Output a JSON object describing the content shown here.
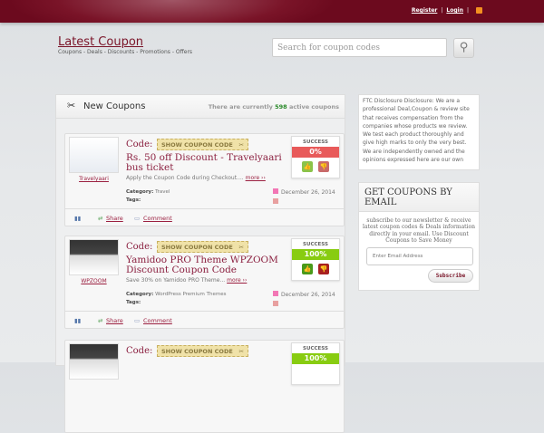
{
  "topbar": {
    "register": "Register",
    "login": "Login",
    "sep": "|"
  },
  "site": {
    "title": "Latest Coupon",
    "tagline": "Coupons - Deals - Discounts - Promotions - Offers"
  },
  "search": {
    "placeholder": "Search for coupon codes"
  },
  "panel": {
    "title": "New Coupons",
    "count_prefix": "There are currently",
    "count": "598",
    "count_suffix": "active coupons"
  },
  "coupons": [
    {
      "store": "Travelyaari",
      "code_label": "Code:",
      "show_code": "SHOW COUPON CODE",
      "title": "Rs. 50 off Discount - Travelyaari bus ticket",
      "desc": "Apply the Coupon Code during Checkout....",
      "more": "more ››",
      "category_label": "Category:",
      "category": "Travel",
      "tags_label": "Tags:",
      "date": "December 26, 2014",
      "success_label": "SUCCESS",
      "success": "0%",
      "share": "Share",
      "comment": "Comment",
      "success_color": "#e85a5a"
    },
    {
      "store": "WPZOOM",
      "code_label": "Code:",
      "show_code": "SHOW COUPON CODE",
      "title": "Yamidoo PRO Theme WPZOOM Discount Coupon Code",
      "desc": "Save 30% on Yamidoo PRO Theme...",
      "more": "more ››",
      "category_label": "Category:",
      "category": "WordPress Premium Themes",
      "tags_label": "Tags:",
      "date": "December 26, 2014",
      "success_label": "SUCCESS",
      "success": "100%",
      "share": "Share",
      "comment": "Comment",
      "success_color": "#88cc11"
    },
    {
      "code_label": "Code:",
      "show_code": "SHOW COUPON CODE",
      "success_label": "SUCCESS",
      "success": "100%",
      "success_color": "#88cc11"
    }
  ],
  "sidebar": {
    "ftc": "FTC Disclosure Disclosure: We are a professional Deal,Coupon & review site that receives compensation from the companies whose products we review. We test each product thoroughly and give high marks to only the very best. We are independently owned and the opinions expressed here are our own",
    "email_title": "GET COUPONS BY EMAIL",
    "email_text": "subscribe to our newsletter & receive latest coupon codes & Deals information directly in your email. Use Discount Coupons to Save Money",
    "email_placeholder": "Enter Email Address",
    "subscribe": "Subscribe"
  }
}
